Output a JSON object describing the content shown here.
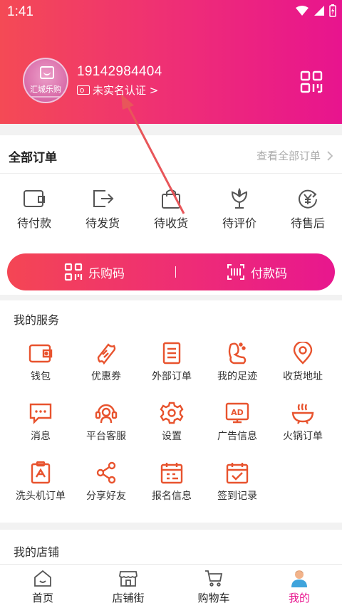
{
  "status_bar": {
    "time": "1:41"
  },
  "profile": {
    "avatar_text": "汇城乐购",
    "phone": "19142984404",
    "verify_text": "未实名认证 >"
  },
  "orders": {
    "title": "全部订单",
    "view_all": "查看全部订单",
    "items": [
      {
        "label": "待付款",
        "icon": "wallet-icon"
      },
      {
        "label": "待发货",
        "icon": "ship-icon"
      },
      {
        "label": "待收货",
        "icon": "bag-icon"
      },
      {
        "label": "待评价",
        "icon": "flower-icon"
      },
      {
        "label": "待售后",
        "icon": "refund-icon"
      }
    ]
  },
  "pay_bar": {
    "left_label": "乐购码",
    "right_label": "付款码"
  },
  "services": {
    "title": "我的服务",
    "items": [
      {
        "label": "钱包",
        "icon": "wallet-icon"
      },
      {
        "label": "优惠券",
        "icon": "coupon-icon"
      },
      {
        "label": "外部订单",
        "icon": "document-icon"
      },
      {
        "label": "我的足迹",
        "icon": "footprint-icon"
      },
      {
        "label": "收货地址",
        "icon": "location-icon"
      },
      {
        "label": "消息",
        "icon": "message-icon"
      },
      {
        "label": "平台客服",
        "icon": "headset-icon"
      },
      {
        "label": "设置",
        "icon": "gear-icon"
      },
      {
        "label": "广告信息",
        "icon": "ad-icon"
      },
      {
        "label": "火锅订单",
        "icon": "hotpot-icon"
      },
      {
        "label": "洗头机订单",
        "icon": "clipboard-icon"
      },
      {
        "label": "分享好友",
        "icon": "share-icon"
      },
      {
        "label": "报名信息",
        "icon": "calendar-icon"
      },
      {
        "label": "签到记录",
        "icon": "checkin-icon"
      }
    ]
  },
  "store": {
    "title": "我的店铺"
  },
  "tabbar": {
    "items": [
      {
        "label": "首页",
        "icon": "home-icon"
      },
      {
        "label": "店铺街",
        "icon": "store-icon"
      },
      {
        "label": "购物车",
        "icon": "cart-icon"
      },
      {
        "label": "我的",
        "icon": "user-icon"
      }
    ],
    "active": "我的"
  },
  "colors": {
    "accent": "#e8148e",
    "gradient_start": "#f44a55",
    "icon_orange": "#e8532e",
    "arrow": "#e8565a"
  }
}
